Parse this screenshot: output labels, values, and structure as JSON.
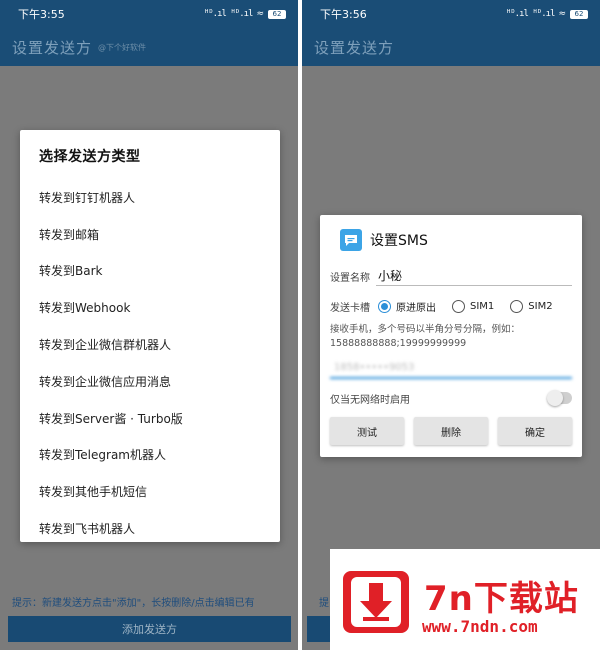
{
  "left": {
    "status_time": "下午3:55",
    "status_signal": "ᴴᴰ.ıl ᴴᴰ.ıl",
    "battery": "62",
    "app_title": "设置发送方",
    "app_subtitle": "@下个好软件",
    "dialog_title": "选择发送方类型",
    "items": [
      "转发到钉钉机器人",
      "转发到邮箱",
      "转发到Bark",
      "转发到Webhook",
      "转发到企业微信群机器人",
      "转发到企业微信应用消息",
      "转发到Server酱 · Turbo版",
      "转发到Telegram机器人",
      "转发到其他手机短信",
      "转发到飞书机器人"
    ],
    "hint": "提示：新建发送方点击\"添加\"，长按删除/点击编辑已有",
    "add_button": "添加发送方"
  },
  "right": {
    "status_time": "下午3:56",
    "status_signal": "ᴴᴰ.ıl ᴴᴰ.ıl",
    "battery": "62",
    "app_title": "设置发送方",
    "hint_fragment": "提",
    "dialog": {
      "title": "设置SMS",
      "name_label": "设置名称",
      "name_value": "小秘",
      "sim_label": "发送卡槽",
      "sim_options": [
        "原进原出",
        "SIM1",
        "SIM2"
      ],
      "recv_label": "接收手机，多个号码以半角分号分隔，例如：15888888888;19999999999",
      "recv_value": "1858•••••9053",
      "toggle_label": "仅当无网络时启用",
      "buttons": [
        "测试",
        "删除",
        "确定"
      ]
    }
  },
  "watermark": {
    "title": "7n下载站",
    "url": "www.7ndn.com"
  },
  "colors": {
    "appbar": "#1a4d76",
    "accent": "#2b8fd8",
    "brand_red": "#e02027"
  }
}
